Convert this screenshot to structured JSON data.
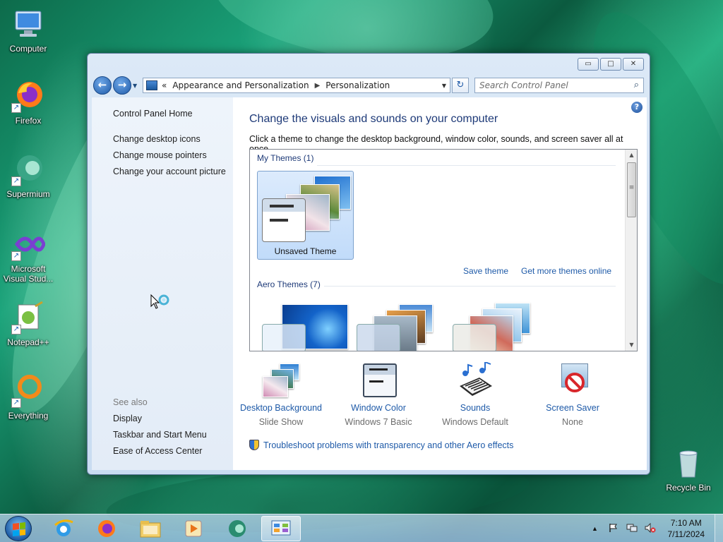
{
  "desktop": {
    "icons": [
      {
        "label": "Computer",
        "icon": "computer-icon"
      },
      {
        "label": "Firefox",
        "icon": "firefox-icon"
      },
      {
        "label": "Supermium",
        "icon": "supermium-icon"
      },
      {
        "label": "Microsoft Visual Stud...",
        "icon": "visual-studio-icon"
      },
      {
        "label": "Notepad++",
        "icon": "notepadpp-icon"
      },
      {
        "label": "Everything",
        "icon": "everything-icon"
      },
      {
        "label": "Recycle Bin",
        "icon": "recycle-bin-icon"
      }
    ]
  },
  "window": {
    "controls": {
      "minimize": "▭",
      "maximize": "□",
      "close": "✕"
    },
    "nav": {
      "back": "←",
      "forward": "→",
      "dropdown": "▼"
    },
    "address": {
      "chevrons": "«",
      "crumb1": "Appearance and Personalization",
      "crumb_sep": "▶",
      "crumb2": "Personalization",
      "dropdown": "▼",
      "refresh": "↻"
    },
    "search": {
      "placeholder": "Search Control Panel",
      "icon": "⌕"
    }
  },
  "left_pane": {
    "home": "Control Panel Home",
    "links": [
      "Change desktop icons",
      "Change mouse pointers",
      "Change your account picture"
    ],
    "see_also_label": "See also",
    "see_also": [
      "Display",
      "Taskbar and Start Menu",
      "Ease of Access Center"
    ]
  },
  "main": {
    "help": "?",
    "title": "Change the visuals and sounds on your computer",
    "subtitle": "Click a theme to change the desktop background, window color, sounds, and screen saver all at once.",
    "my_themes_label": "My Themes (1)",
    "unsaved_theme": "Unsaved Theme",
    "save_theme": "Save theme",
    "get_more": "Get more themes online",
    "aero_themes_label": "Aero Themes (7)",
    "scroll_up": "▲",
    "scroll_down": "▼",
    "scroll_grip": "≡",
    "bottom": [
      {
        "title": "Desktop Background",
        "sub": "Slide Show"
      },
      {
        "title": "Window Color",
        "sub": "Windows 7 Basic"
      },
      {
        "title": "Sounds",
        "sub": "Windows Default"
      },
      {
        "title": "Screen Saver",
        "sub": "None"
      }
    ],
    "troubleshoot": "Troubleshoot problems with transparency and other Aero effects"
  },
  "taskbar": {
    "clock_time": "7:10 AM",
    "clock_date": "7/11/2024",
    "tray_up": "▲"
  }
}
